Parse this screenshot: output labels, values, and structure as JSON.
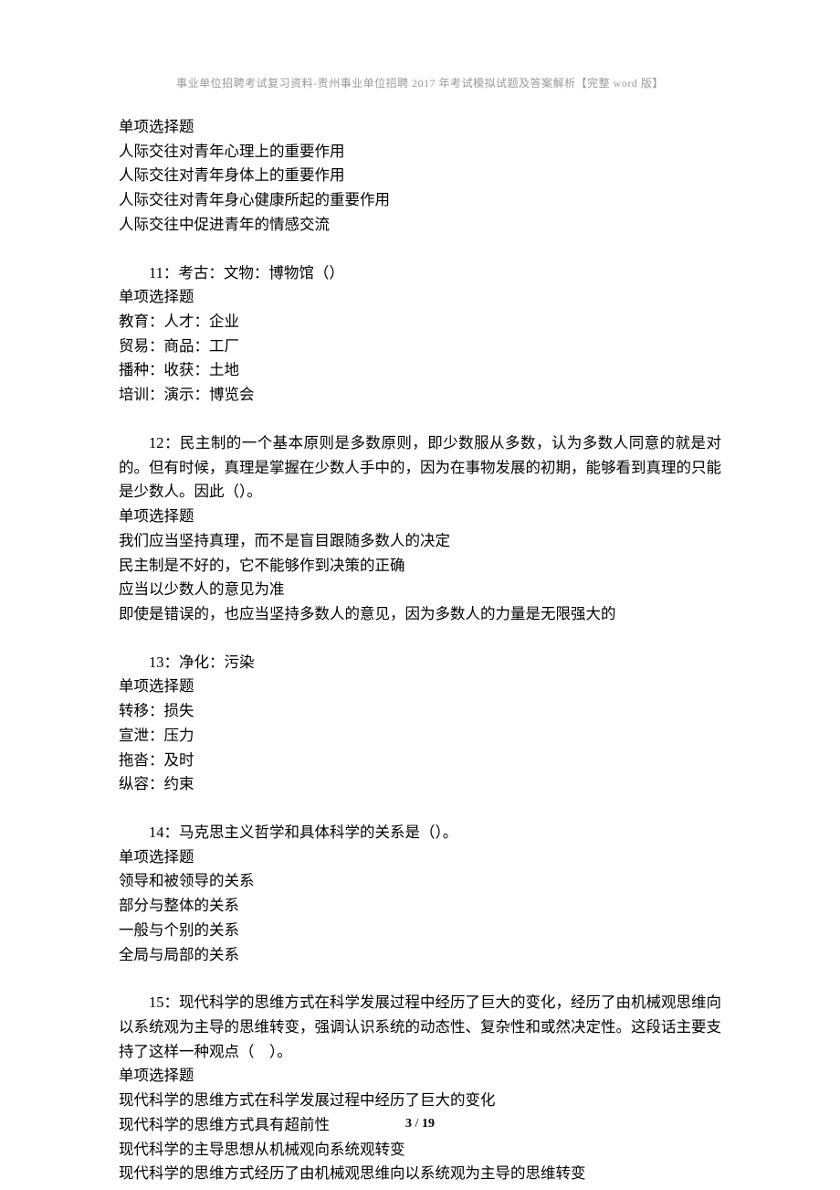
{
  "header": "事业单位招聘考试复习资料-贵州事业单位招聘 2017 年考试模拟试题及答案解析【完整 word 版】",
  "footer": {
    "page": "3",
    "sep": " / ",
    "total": "19"
  },
  "blocks": [
    {
      "lines": [
        "单项选择题",
        "人际交往对青年心理上的重要作用",
        "人际交往对青年身体上的重要作用",
        "人际交往对青年身心健康所起的重要作用",
        "人际交往中促进青年的情感交流"
      ]
    },
    {
      "first": "11：考古：文物：博物馆（）",
      "lines": [
        "单项选择题",
        "教育：人才：企业",
        "贸易：商品：工厂",
        "播种：收获：土地",
        "培训：演示：博览会"
      ]
    },
    {
      "first": "12：民主制的一个基本原则是多数原则，即少数服从多数，认为多数人同意的就是对的。但有时候，真理是掌握在少数人手中的，因为在事物发展的初期，能够看到真理的只能是少数人。因此（）。",
      "lines": [
        "单项选择题",
        "我们应当坚持真理，而不是盲目跟随多数人的决定",
        "民主制是不好的，它不能够作到决策的正确",
        "应当以少数人的意见为准",
        "即使是错误的，也应当坚持多数人的意见，因为多数人的力量是无限强大的"
      ]
    },
    {
      "first": "13：净化：污染",
      "lines": [
        "单项选择题",
        "转移：损失",
        "宣泄：压力",
        "拖沓：及时",
        "纵容：约束"
      ]
    },
    {
      "first": "14：马克思主义哲学和具体科学的关系是（）。",
      "lines": [
        "单项选择题",
        "领导和被领导的关系",
        "部分与整体的关系",
        "一般与个别的关系",
        "全局与局部的关系"
      ]
    },
    {
      "first": "15：现代科学的思维方式在科学发展过程中经历了巨大的变化，经历了由机械观思维向以系统观为主导的思维转变，强调认识系统的动态性、复杂性和或然决定性。这段话主要支持了这样一种观点（　）。",
      "lines": [
        "单项选择题",
        "现代科学的思维方式在科学发展过程中经历了巨大的变化",
        "现代科学的思维方式具有超前性",
        "现代科学的主导思想从机械观向系统观转变",
        "现代科学的思维方式经历了由机械观思维向以系统观为主导的思维转变"
      ]
    }
  ]
}
